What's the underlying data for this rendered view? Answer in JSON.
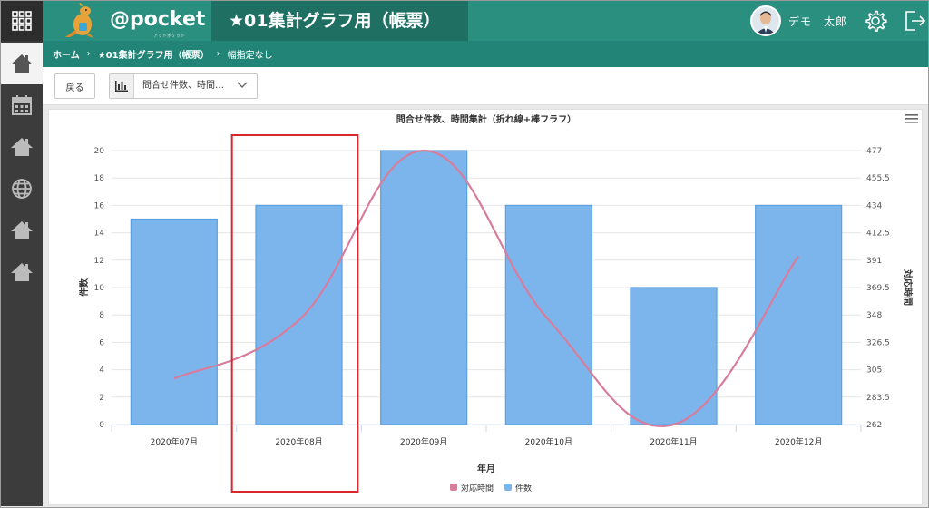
{
  "rail": {
    "items": [
      "apps-grid",
      "home",
      "calendar",
      "home",
      "globe",
      "home",
      "home"
    ]
  },
  "header": {
    "logo": "@pocket",
    "logo_sub": "アットポケット",
    "title": "★01集計グラフ用（帳票）",
    "user_name": "デモ　太郎"
  },
  "breadcrumb": {
    "items": [
      "ホーム",
      "★01集計グラフ用（帳票）",
      "幅指定なし"
    ],
    "separator": "›"
  },
  "toolbar": {
    "back_label": "戻る",
    "select_value": "問合せ件数、時間…"
  },
  "colors": {
    "header": "#2a8f7f",
    "bar": "#7cb5ec",
    "line": "#d87c9c",
    "highlight": "#d9272e"
  },
  "chart_data": {
    "type": "bar",
    "title": "問合せ件数、時間集計（折れ線+棒フラフ）",
    "xlabel": "年月",
    "ylabel": "件数",
    "y2label": "対応時間",
    "categories": [
      "2020年07月",
      "2020年08月",
      "2020年09月",
      "2020年10月",
      "2020年11月",
      "2020年12月"
    ],
    "series": [
      {
        "name": "件数",
        "type": "bar",
        "axis": "left",
        "values": [
          15,
          16,
          20,
          16,
          10,
          16
        ]
      },
      {
        "name": "対応時間",
        "type": "line",
        "axis": "right",
        "values": [
          298,
          344,
          477,
          344,
          262,
          394
        ]
      }
    ],
    "ylim": [
      0,
      20
    ],
    "yticks": [
      "0",
      "2",
      "4",
      "6",
      "8",
      "10",
      "12",
      "14",
      "16",
      "18",
      "20"
    ],
    "y2lim": [
      262,
      477
    ],
    "y2ticks": [
      "262",
      "283.5",
      "305",
      "326.5",
      "348",
      "369.5",
      "391",
      "412.5",
      "434",
      "455.5",
      "477"
    ],
    "legend": "bottom",
    "legend_items": [
      "対応時間",
      "件数"
    ],
    "grid": true
  }
}
